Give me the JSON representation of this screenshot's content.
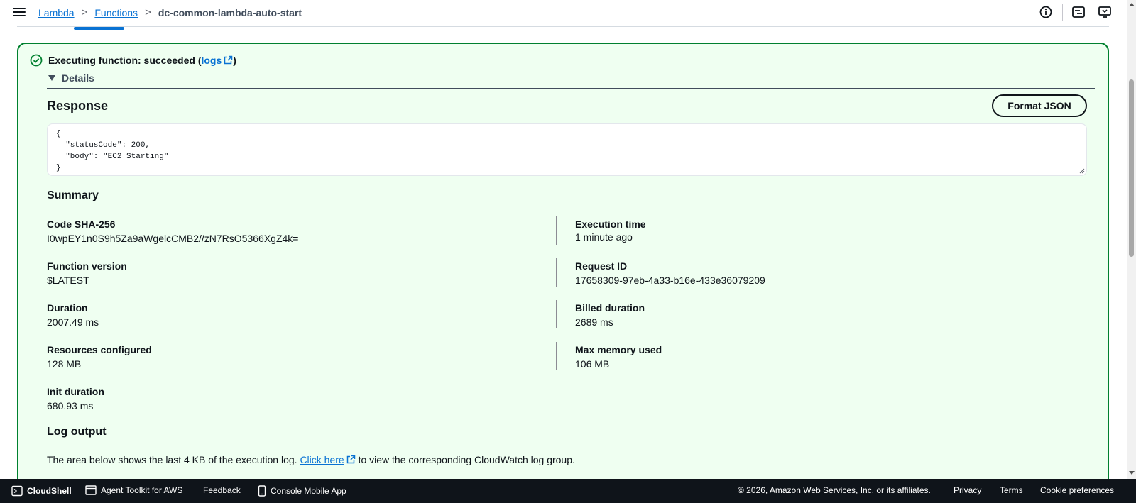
{
  "breadcrumb": {
    "items": [
      "Lambda",
      "Functions"
    ],
    "separator": ">",
    "current": "dc-common-lambda-auto-start"
  },
  "header_icons": [
    "info-icon",
    "split-panel-icon",
    "feedback-screen-icon"
  ],
  "status": {
    "prefix": "Executing function: succeeded (",
    "link": "logs",
    "suffix": ")",
    "icon": "success-check-icon",
    "color": "#00802f"
  },
  "details": {
    "label": "Details"
  },
  "response": {
    "title": "Response",
    "format_button": "Format JSON",
    "body": "{\n  \"statusCode\": 200,\n  \"body\": \"EC2 Starting\"\n}"
  },
  "summary": {
    "title": "Summary",
    "left": [
      {
        "label": "Code SHA-256",
        "value": "I0wpEY1n0S9h5Za9aWgelcCMB2//zN7RsO5366XgZ4k="
      },
      {
        "label": "Function version",
        "value": "$LATEST"
      },
      {
        "label": "Duration",
        "value": "2007.49 ms"
      },
      {
        "label": "Resources configured",
        "value": "128 MB"
      },
      {
        "label": "Init duration",
        "value": "680.93 ms"
      }
    ],
    "right": [
      {
        "label": "Execution time",
        "value": "1 minute ago"
      },
      {
        "label": "Request ID",
        "value": "17658309-97eb-4a33-b16e-433e36079209"
      },
      {
        "label": "Billed duration",
        "value": "2689 ms"
      },
      {
        "label": "Max memory used",
        "value": "106 MB"
      }
    ]
  },
  "log_output": {
    "title": "Log output",
    "text_before": "The area below shows the last 4 KB of the execution log. ",
    "link": "Click here",
    "text_after": " to view the corresponding CloudWatch log group."
  },
  "footer": {
    "cloudshell": "CloudShell",
    "agent_toolkit": "Agent Toolkit for AWS",
    "feedback": "Feedback",
    "mobile_app": "Console Mobile App",
    "copyright": "© 2026, Amazon Web Services, Inc. or its affiliates.",
    "privacy": "Privacy",
    "terms": "Terms",
    "cookies": "Cookie preferences"
  },
  "colors": {
    "link": "#0972d3",
    "success_bg": "#effff1",
    "success_border": "#00802f",
    "footer_bg": "#0f141a"
  }
}
